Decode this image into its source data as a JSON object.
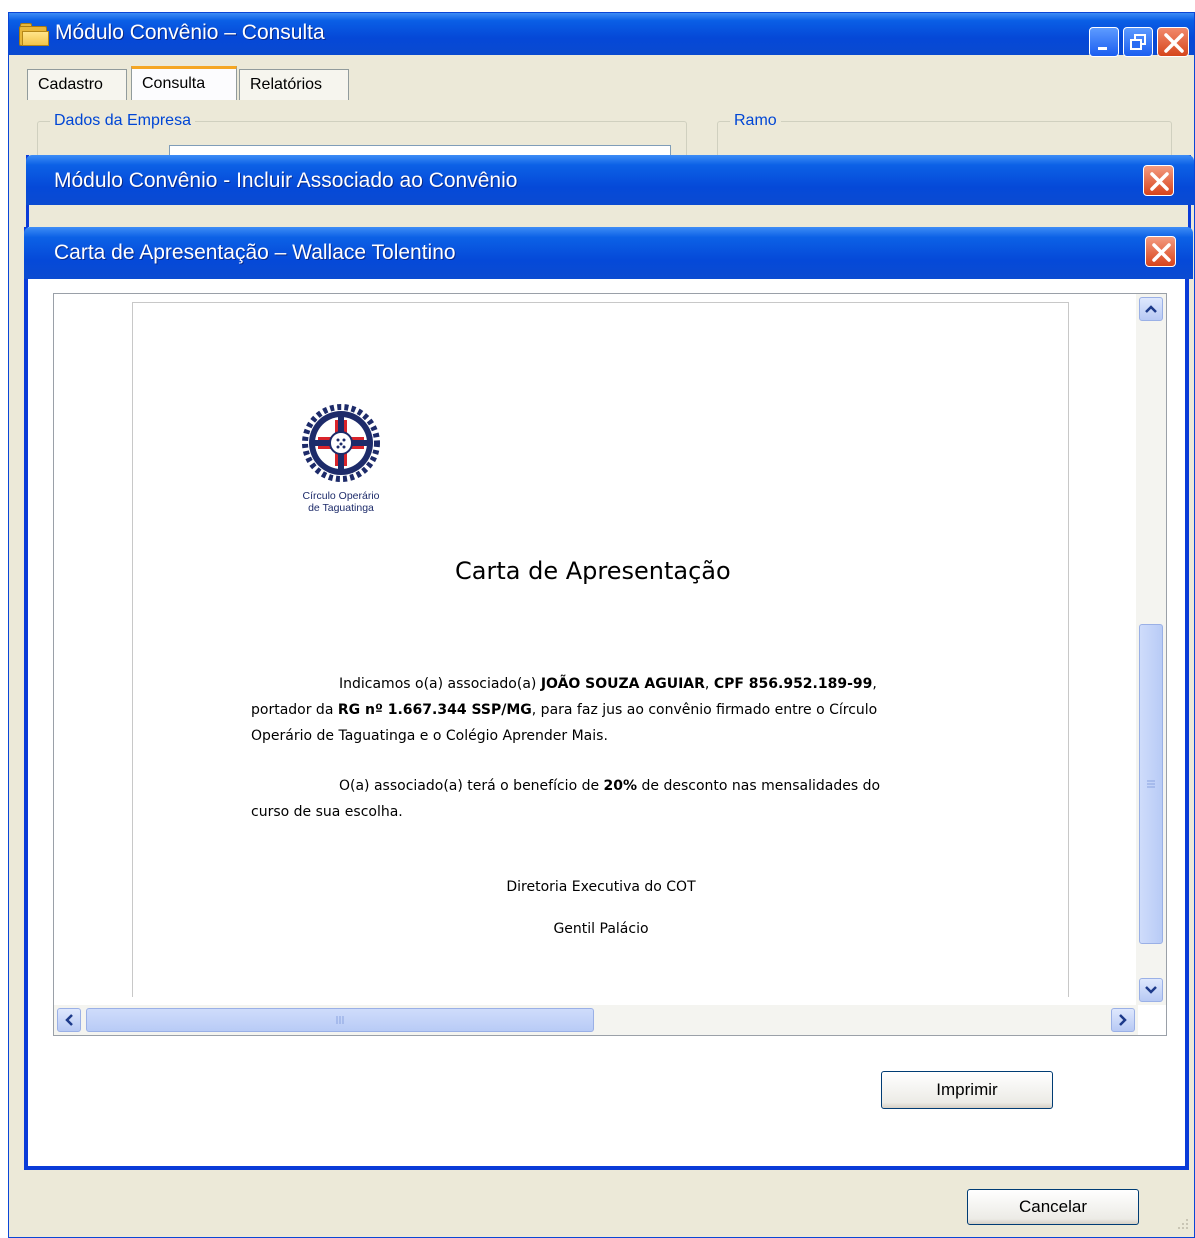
{
  "main_window": {
    "title": "Módulo Convênio – Consulta",
    "tabs": [
      {
        "label": "Cadastro"
      },
      {
        "label": "Consulta"
      },
      {
        "label": "Relatórios"
      }
    ],
    "groups": {
      "dados_empresa": "Dados da Empresa",
      "ramo": "Ramo"
    },
    "cancel_label": "Cancelar"
  },
  "include_dialog": {
    "title": "Módulo Convênio - Incluir Associado ao Convênio"
  },
  "letter_dialog": {
    "title": "Carta de Apresentação – Wallace Tolentino",
    "print_label": "Imprimir",
    "document": {
      "logo_line1": "Círculo Operário",
      "logo_line2": "de Taguatinga",
      "title": "Carta de Apresentação",
      "para1": {
        "t1": "Indicamos o(a) associado(a) ",
        "name": "JOÃO SOUZA AGUIAR",
        "t2": ", ",
        "cpf": "CPF 856.952.189-99",
        "t3": ",",
        "t4": "portador da ",
        "rg": "RG nº 1.667.344 SSP/MG",
        "t5": ", para faz jus ao convênio firmado entre o Círculo",
        "t6": "Operário de Taguatinga e o Colégio Aprender Mais."
      },
      "para2": {
        "t1": "O(a) associado(a) terá o benefício de ",
        "discount": "20%",
        "t2": " de desconto nas mensalidades do",
        "t3": "curso de sua escolha."
      },
      "signature_role": "Diretoria Executiva do COT",
      "signature_name": "Gentil Palácio"
    }
  },
  "colors": {
    "titlebar_blue": "#0549d8",
    "legend_blue": "#0046d5",
    "window_bg": "#ece9d8",
    "close_red": "#d8431b"
  }
}
